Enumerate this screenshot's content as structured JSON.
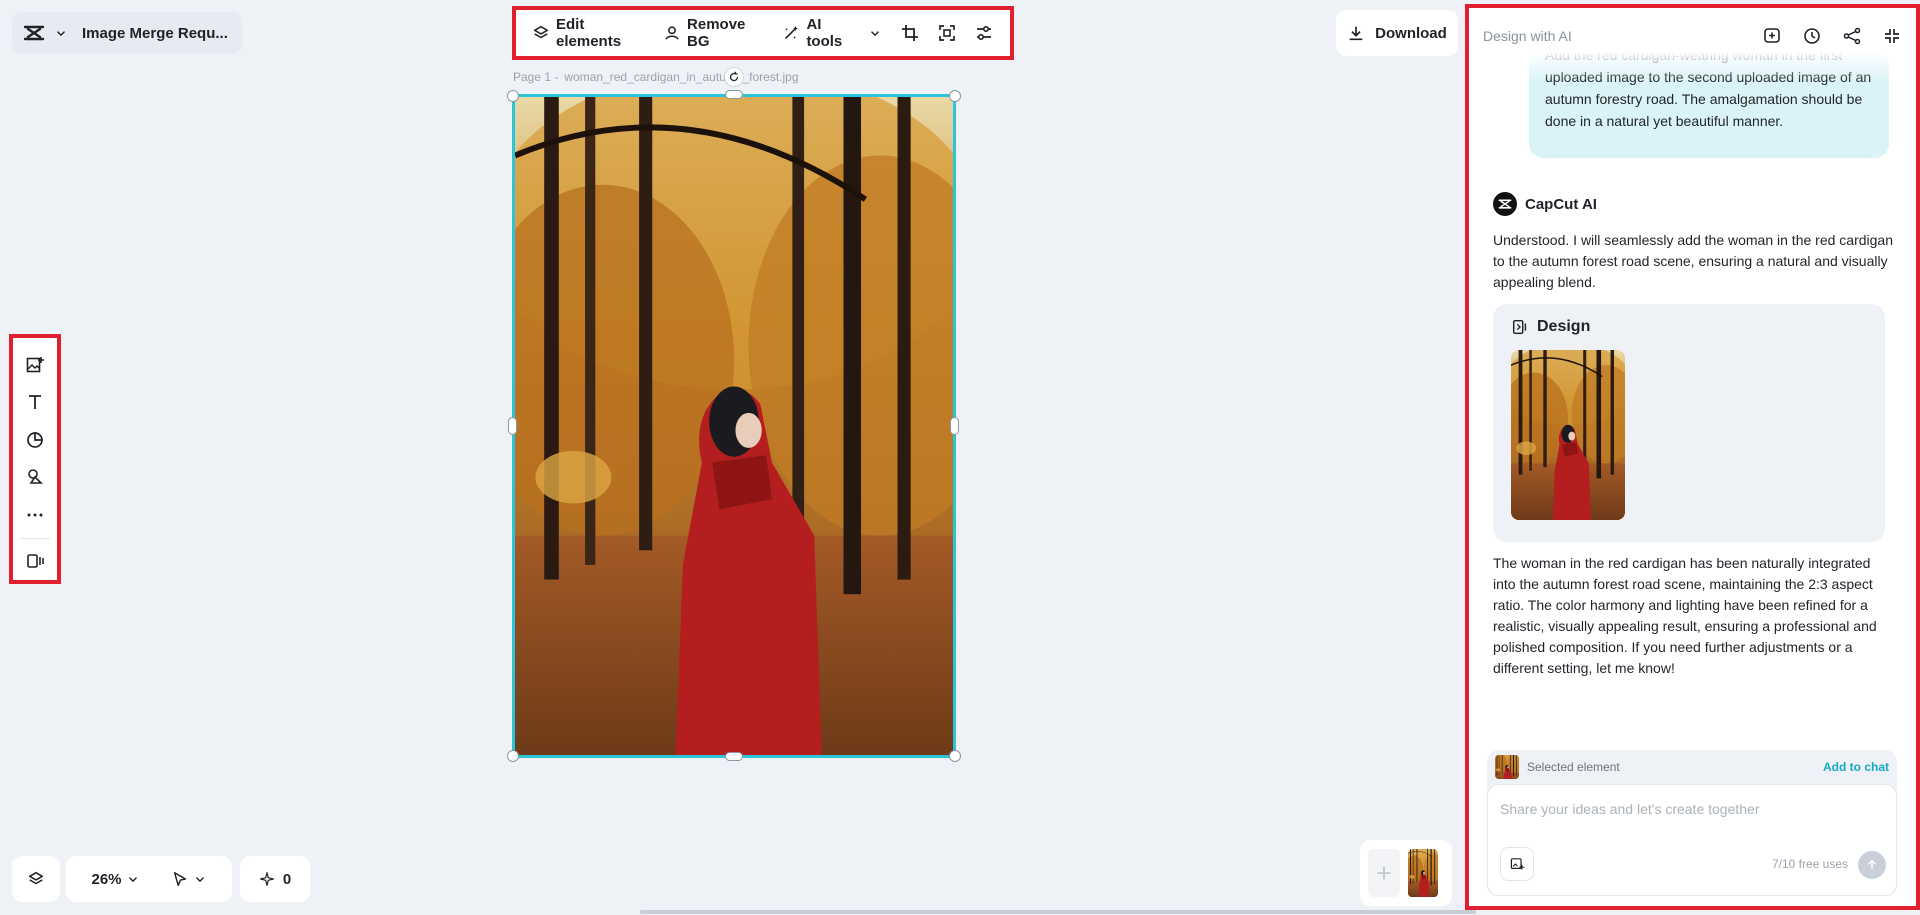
{
  "project": {
    "title": "Image Merge Requ..."
  },
  "toolbar": {
    "edit_elements": "Edit elements",
    "remove_bg": "Remove BG",
    "ai_tools": "AI tools"
  },
  "download_label": "Download",
  "canvas": {
    "page_label": "Page 1 -",
    "file_name": "woman_red_cardigan_in_autumn_forest.jpg"
  },
  "zoom": {
    "level": "26%"
  },
  "credits": {
    "count": "0"
  },
  "panel": {
    "title": "Design with AI",
    "user_message": "Add the red cardigan-wearing woman in the first uploaded image to the second uploaded image of an autumn forestry road. The amalgamation should be done in a natural yet beautiful manner.",
    "ai_name": "CapCut AI",
    "ai_reply_1": "Understood. I will seamlessly add the woman in the red cardigan to the autumn forest road scene, ensuring a natural and visually appealing blend.",
    "design_card_title": "Design",
    "ai_reply_2": "The woman in the red cardigan has been naturally integrated into the autumn forest road scene, maintaining the 2:3 aspect ratio. The color harmony and lighting have been refined for a realistic, visually appealing result, ensuring a professional and polished composition. If you need further adjustments or a different setting, let me know!",
    "selected_element": "Selected element",
    "add_to_chat": "Add to chat",
    "input_placeholder": "Share your ideas and let's create together",
    "free_uses": "7/10 free uses"
  },
  "colors": {
    "highlight": "#e0202e",
    "selection": "#2bc4d8",
    "accent": "#17a8c4"
  }
}
